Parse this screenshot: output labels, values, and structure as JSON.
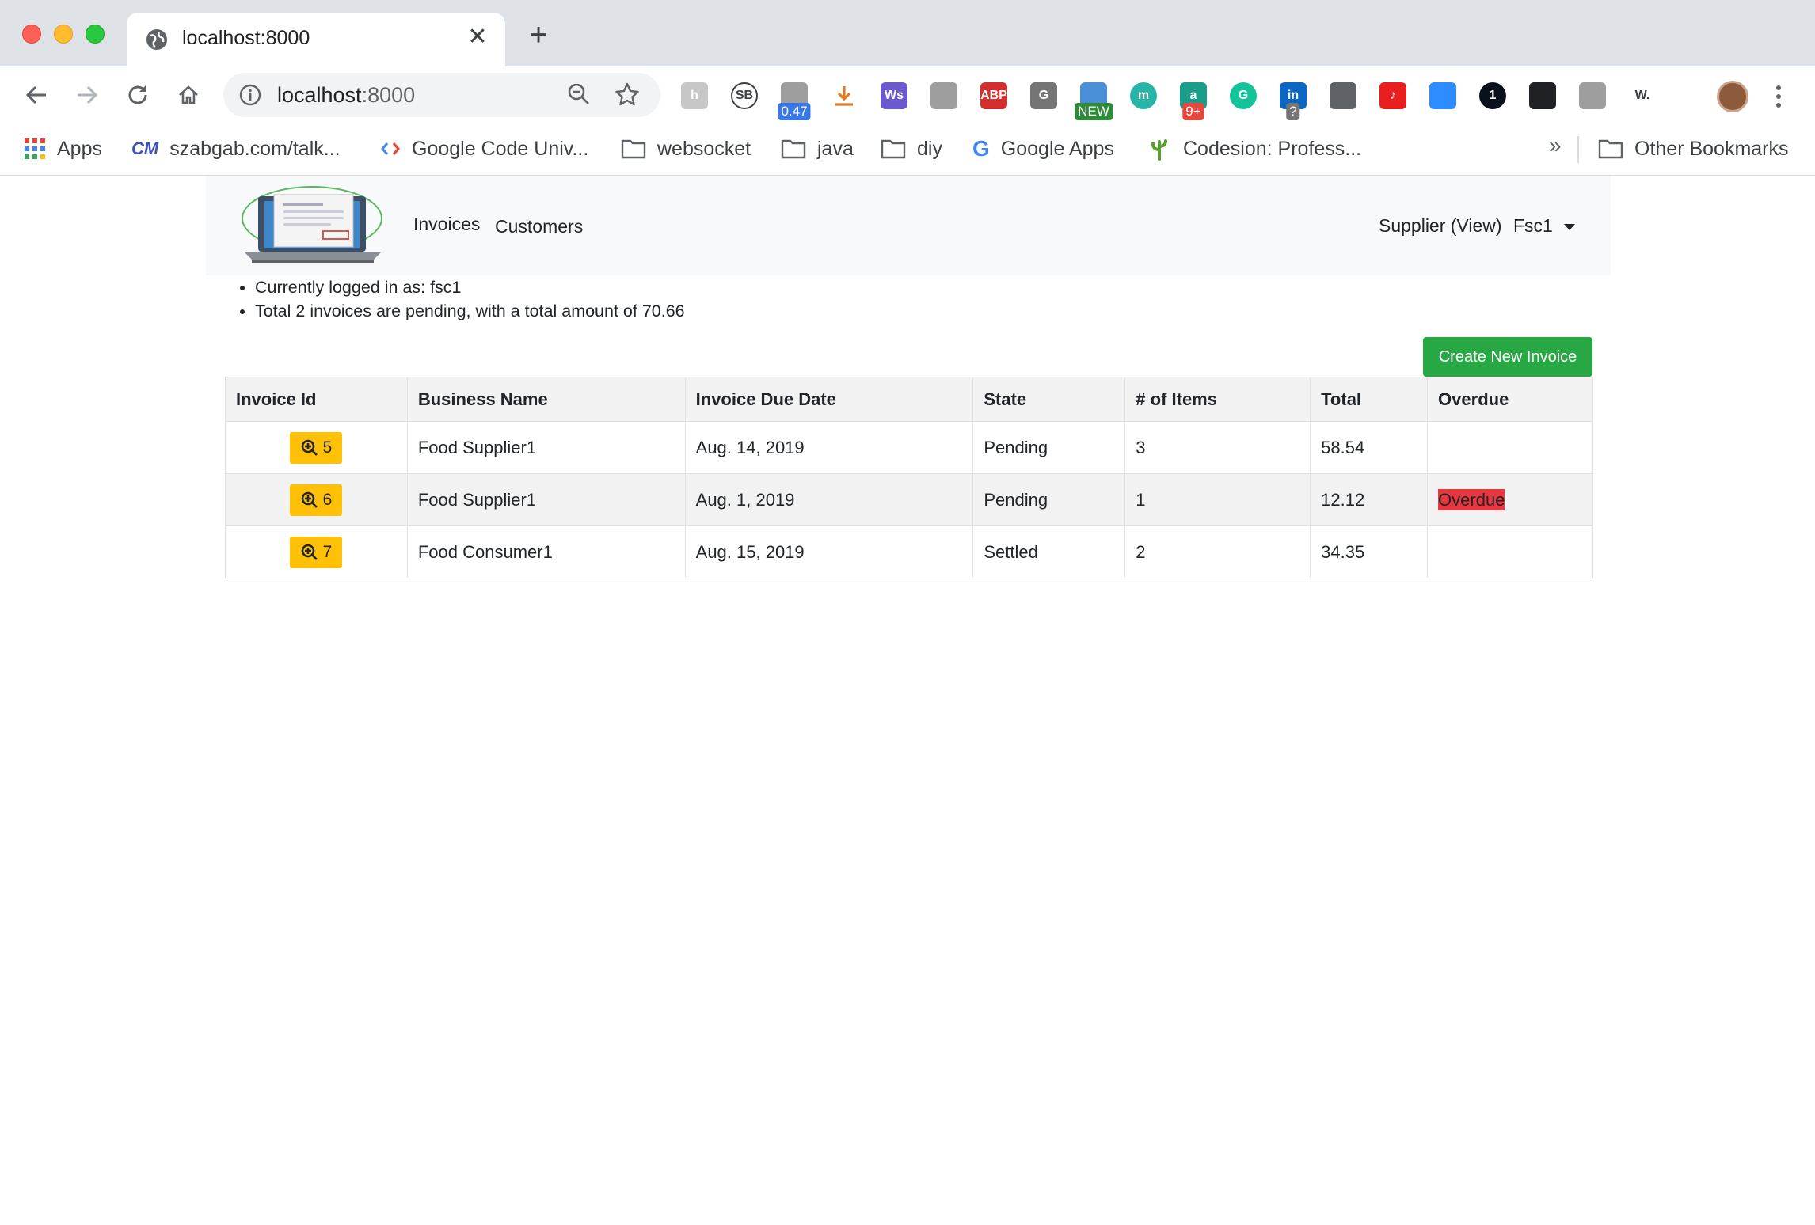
{
  "browser": {
    "tab_title": "localhost:8000",
    "url_host": "localhost",
    "url_port": ":8000",
    "extensions": [
      {
        "name": "honey-extension-icon",
        "label": "h",
        "color": "#c7c7c7"
      },
      {
        "name": "sb-extension-icon",
        "label": "SB",
        "color": "#ffffff"
      },
      {
        "name": "speed-extension-icon",
        "label": "",
        "color": "#9e9e9e",
        "badge": "0.47",
        "badge_color": "#3b78e7"
      },
      {
        "name": "download-extension-icon",
        "label": "",
        "color": "#ffffff"
      },
      {
        "name": "ws-extension-icon",
        "label": "Ws",
        "color": "#6a5acd"
      },
      {
        "name": "film-extension-icon",
        "label": "",
        "color": "#9e9e9e"
      },
      {
        "name": "abp-extension-icon",
        "label": "ABP",
        "color": "#d32f2f"
      },
      {
        "name": "g-extension-icon",
        "label": "G",
        "color": "#757575"
      },
      {
        "name": "new-extension-icon",
        "label": "",
        "color": "#4a90d9",
        "badge": "NEW",
        "badge_color": "#2e8b3a"
      },
      {
        "name": "m-extension-icon",
        "label": "m",
        "color": "#26b5a6"
      },
      {
        "name": "a-extension-icon",
        "label": "a",
        "color": "#1a9e8a",
        "badge": "9+",
        "badge_color": "#e8453c"
      },
      {
        "name": "grammarly-extension-icon",
        "label": "G",
        "color": "#15c39a"
      },
      {
        "name": "linkedin-extension-icon",
        "label": "in",
        "color": "#0a66c2",
        "badge": "?",
        "badge_color": "#757575"
      },
      {
        "name": "bulb-extension-icon",
        "label": "",
        "color": "#5f6368"
      },
      {
        "name": "music-extension-icon",
        "label": "♪",
        "color": "#e91e1e"
      },
      {
        "name": "zoom-extension-icon",
        "label": "",
        "color": "#2d8cff"
      },
      {
        "name": "onepassword-extension-icon",
        "label": "1",
        "color": "#0a0f1c"
      },
      {
        "name": "glasses-extension-icon",
        "label": "",
        "color": "#202124"
      },
      {
        "name": "gallery-extension-icon",
        "label": "",
        "color": "#9e9e9e"
      },
      {
        "name": "w-extension-icon",
        "label": "W.",
        "color": "#ffffff"
      }
    ],
    "bookmarks": [
      {
        "name": "bookmark-apps",
        "label": "Apps",
        "icon": "apps-grid-icon"
      },
      {
        "name": "bookmark-szabgab",
        "label": "szabgab.com/talk...",
        "icon": "cm-icon"
      },
      {
        "name": "bookmark-google-code",
        "label": "Google Code Univ...",
        "icon": "code-icon"
      },
      {
        "name": "bookmark-websocket",
        "label": "websocket",
        "icon": "folder-icon"
      },
      {
        "name": "bookmark-java",
        "label": "java",
        "icon": "folder-icon"
      },
      {
        "name": "bookmark-diy",
        "label": "diy",
        "icon": "folder-icon"
      },
      {
        "name": "bookmark-google-apps",
        "label": "Google Apps",
        "icon": "google-icon"
      },
      {
        "name": "bookmark-codesion",
        "label": "Codesion: Profess...",
        "icon": "cactus-icon"
      }
    ],
    "bookmarks_more": "»",
    "other_bookmarks": "Other Bookmarks"
  },
  "navbar": {
    "links": [
      "Invoices",
      "Customers"
    ],
    "role": "Supplier (View)",
    "user": "Fsc1"
  },
  "info": {
    "logged_in": "Currently logged in as: fsc1",
    "pending": "Total 2 invoices are pending, with a total amount of 70.66"
  },
  "create_button": "Create New Invoice",
  "table": {
    "headers": [
      "Invoice Id",
      "Business Name",
      "Invoice Due Date",
      "State",
      "# of Items",
      "Total",
      "Overdue"
    ],
    "rows": [
      {
        "id": "5",
        "business": "Food Supplier1",
        "due": "Aug. 14, 2019",
        "state": "Pending",
        "items": "3",
        "total": "58.54",
        "overdue": ""
      },
      {
        "id": "6",
        "business": "Food Supplier1",
        "due": "Aug. 1, 2019",
        "state": "Pending",
        "items": "1",
        "total": "12.12",
        "overdue": "Overdue"
      },
      {
        "id": "7",
        "business": "Food Consumer1",
        "due": "Aug. 15, 2019",
        "state": "Settled",
        "items": "2",
        "total": "34.35",
        "overdue": ""
      }
    ]
  },
  "colors": {
    "create_button": "#28a745",
    "view_button": "#ffc107",
    "overdue": "#e8373f"
  }
}
